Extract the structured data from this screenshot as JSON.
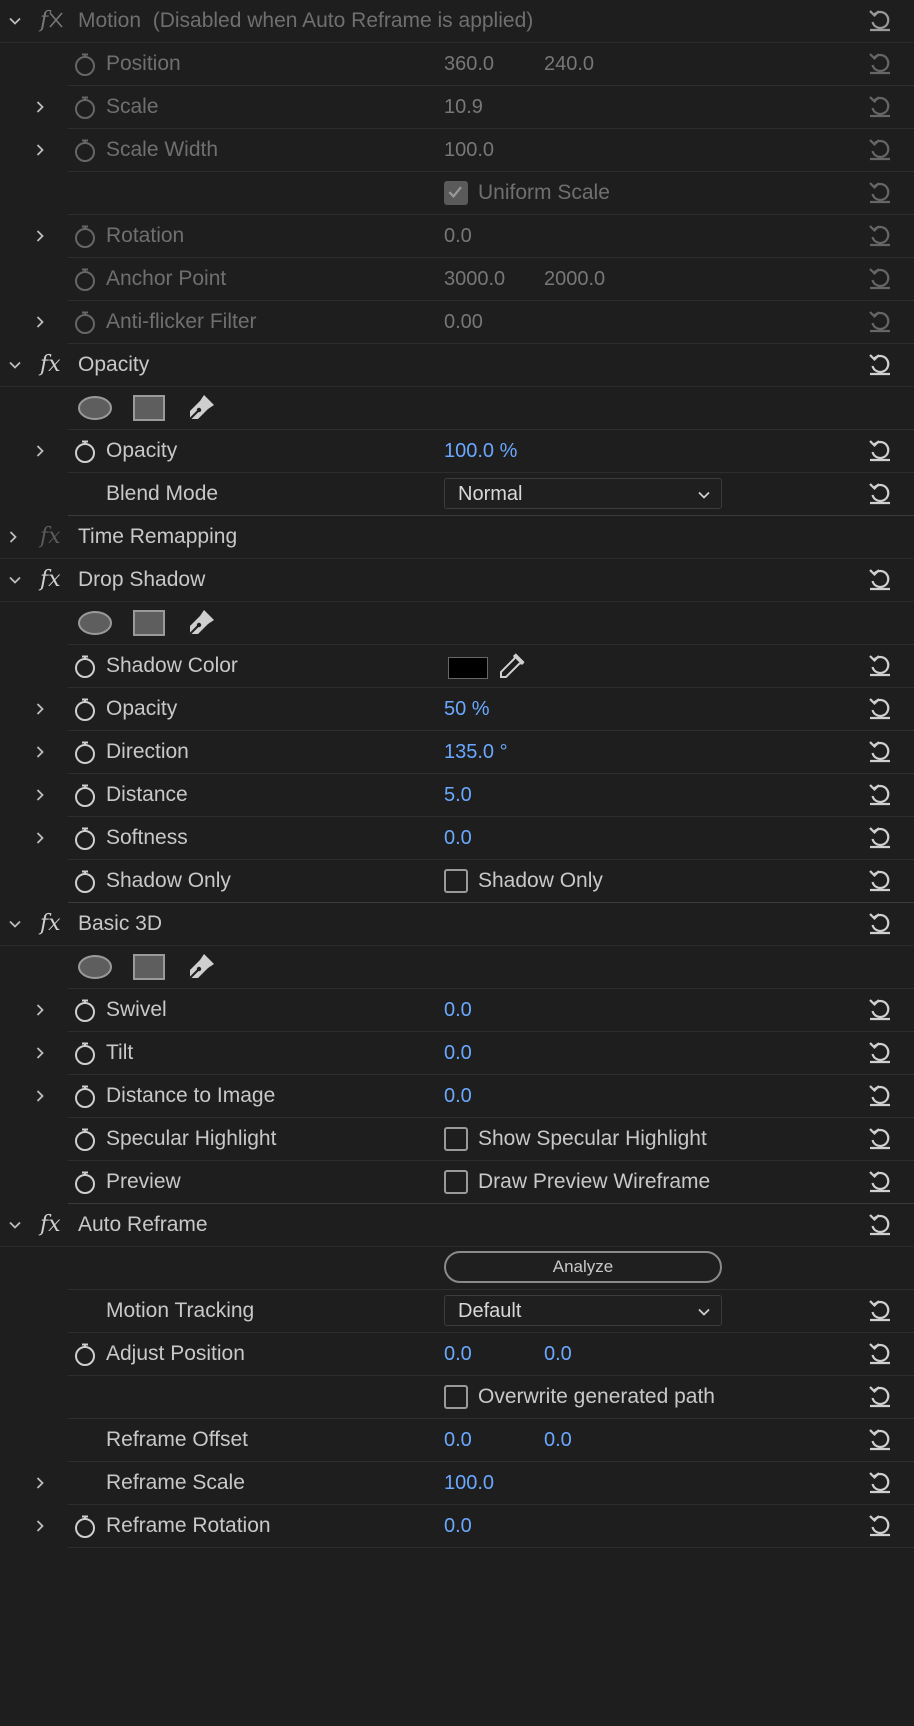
{
  "motion": {
    "title": "Motion",
    "subtitle": "(Disabled when Auto Reframe is applied)",
    "position_label": "Position",
    "position_x": "360.0",
    "position_y": "240.0",
    "scale_label": "Scale",
    "scale": "10.9",
    "scale_width_label": "Scale Width",
    "scale_width": "100.0",
    "uniform_scale_label": "Uniform Scale",
    "rotation_label": "Rotation",
    "rotation": "0.0",
    "anchor_label": "Anchor Point",
    "anchor_x": "3000.0",
    "anchor_y": "2000.0",
    "antiflicker_label": "Anti-flicker Filter",
    "antiflicker": "0.00"
  },
  "opacity": {
    "title": "Opacity",
    "opacity_label": "Opacity",
    "opacity": "100.0 %",
    "blend_label": "Blend Mode",
    "blend": "Normal"
  },
  "time_remapping": {
    "title": "Time Remapping"
  },
  "drop_shadow": {
    "title": "Drop Shadow",
    "color_label": "Shadow Color",
    "opacity_label": "Opacity",
    "opacity": "50 %",
    "direction_label": "Direction",
    "direction": "135.0 °",
    "distance_label": "Distance",
    "distance": "5.0",
    "softness_label": "Softness",
    "softness": "0.0",
    "shadow_only_label": "Shadow Only",
    "shadow_only_cb": "Shadow Only"
  },
  "basic3d": {
    "title": "Basic 3D",
    "swivel_label": "Swivel",
    "swivel": "0.0",
    "tilt_label": "Tilt",
    "tilt": "0.0",
    "dist_label": "Distance to Image",
    "dist": "0.0",
    "specular_label": "Specular Highlight",
    "specular_cb": "Show Specular Highlight",
    "preview_label": "Preview",
    "preview_cb": "Draw Preview Wireframe"
  },
  "auto_reframe": {
    "title": "Auto Reframe",
    "analyze": "Analyze",
    "tracking_label": "Motion Tracking",
    "tracking": "Default",
    "adjust_label": "Adjust Position",
    "adjust_x": "0.0",
    "adjust_y": "0.0",
    "overwrite_cb": "Overwrite generated path",
    "offset_label": "Reframe Offset",
    "offset_x": "0.0",
    "offset_y": "0.0",
    "scale_label": "Reframe Scale",
    "scale": "100.0",
    "rotation_label": "Reframe Rotation",
    "rotation": "0.0"
  }
}
